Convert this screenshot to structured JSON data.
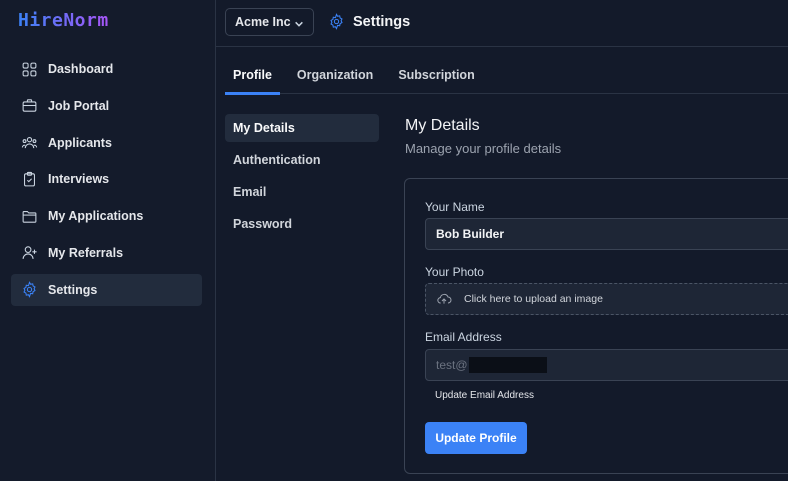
{
  "app": {
    "logo_text": "HireNorm"
  },
  "sidebar": {
    "items": [
      {
        "label": "Dashboard",
        "icon": "grid-icon"
      },
      {
        "label": "Job Portal",
        "icon": "briefcase-icon"
      },
      {
        "label": "Applicants",
        "icon": "users-icon"
      },
      {
        "label": "Interviews",
        "icon": "clipboard-icon"
      },
      {
        "label": "My Applications",
        "icon": "folder-icon"
      },
      {
        "label": "My Referrals",
        "icon": "user-plus-icon"
      },
      {
        "label": "Settings",
        "icon": "gear-icon",
        "active": true
      }
    ]
  },
  "header": {
    "org_select_value": "Acme Inc",
    "page_title": "Settings"
  },
  "tabs": [
    {
      "label": "Profile",
      "active": true
    },
    {
      "label": "Organization"
    },
    {
      "label": "Subscription"
    }
  ],
  "subnav": [
    {
      "label": "My Details",
      "active": true
    },
    {
      "label": "Authentication"
    },
    {
      "label": "Email"
    },
    {
      "label": "Password"
    }
  ],
  "section": {
    "title": "My Details",
    "subtitle": "Manage your profile details"
  },
  "form": {
    "name_label": "Your Name",
    "name_value": "Bob Builder",
    "photo_label": "Your Photo",
    "upload_text": "Click here to upload an image",
    "email_label": "Email Address",
    "email_value": "test@",
    "update_email_link": "Update Email Address",
    "submit_label": "Update Profile"
  },
  "colors": {
    "accent": "#3b82f6",
    "background": "#131a2a",
    "active_item_bg": "#222c3d"
  }
}
